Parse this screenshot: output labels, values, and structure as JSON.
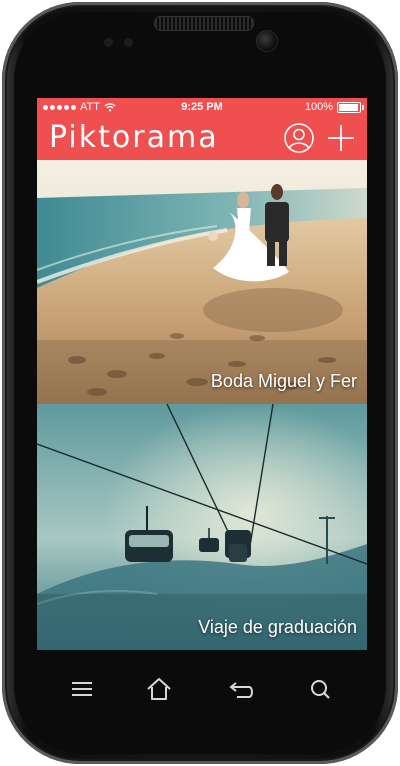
{
  "status_bar": {
    "carrier": "ATT",
    "time": "9:25 PM",
    "battery": "100%"
  },
  "header": {
    "title": "Piktorama",
    "profile_icon": "user-circle-icon",
    "add_icon": "plus-icon"
  },
  "albums": [
    {
      "caption": "Boda Miguel y Fer"
    },
    {
      "caption": "Viaje de graduación"
    }
  ],
  "softkeys": {
    "menu_icon": "menu-icon",
    "home_icon": "home-icon",
    "back_icon": "back-icon",
    "search_icon": "search-icon"
  },
  "colors": {
    "accent": "#ef4f4f"
  }
}
